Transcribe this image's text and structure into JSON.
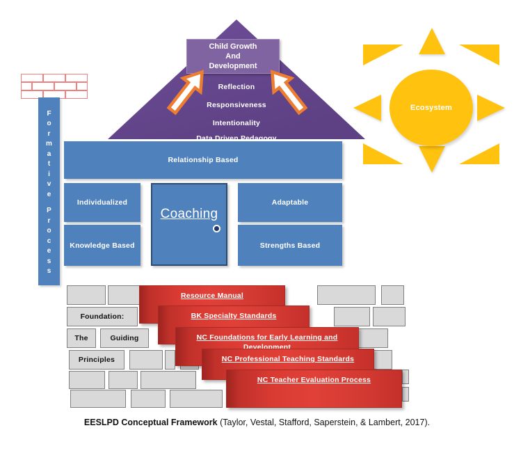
{
  "figure": {
    "caption_bold": "EESLPD Conceptual Framework",
    "caption_rest": " (Taylor, Vestal, Stafford, Saperstein, & Lambert, 2017)."
  },
  "colors": {
    "roof_purple": "#6E4F99",
    "header_purple": "#8064A2",
    "house_blue": "#4F81BD",
    "door_border": "#2B4B73",
    "sun_yellow": "#FFC20E",
    "banner_red": "#D93B33",
    "brick_gray": "#D9D9D9",
    "brick_gray_border": "#808080",
    "chimney_red": "#F08080",
    "arrow_orange": "#ED7D31"
  },
  "sun": {
    "label": "Ecosystem",
    "ray_count": 8
  },
  "chimney": {
    "rows": 3,
    "bricks_per_row": [
      3,
      4,
      3
    ]
  },
  "formative": {
    "label": "Formative Process",
    "letters_line1": [
      "F",
      "o",
      "r",
      "m",
      "a",
      "t",
      "i",
      "v",
      "e"
    ],
    "letters_line2": [
      "P",
      "r",
      "o",
      "c",
      "e",
      "s",
      "s"
    ]
  },
  "roof": {
    "header_box_lines": [
      "Child Growth",
      "And",
      "Development"
    ],
    "principles": [
      "Reflection",
      "Responsiveness",
      "Intentionality",
      "Data Driven Pedagogy"
    ]
  },
  "house": {
    "boxes": [
      {
        "id": "relationship",
        "label": "Relationship Based"
      },
      {
        "id": "individualized",
        "label": "Individualized"
      },
      {
        "id": "knowledge",
        "label": "Knowledge Based"
      },
      {
        "id": "adaptable",
        "label": "Adaptable"
      },
      {
        "id": "strengths",
        "label": "Strengths Based"
      },
      {
        "id": "coaching",
        "label": "Coaching"
      }
    ]
  },
  "foundation": {
    "labeled_bricks": [
      {
        "label": "Foundation:"
      },
      {
        "label": "The"
      },
      {
        "label": "Guiding"
      },
      {
        "label": "Principles"
      }
    ],
    "banners": [
      {
        "label": "Resource Manual"
      },
      {
        "label": "BK Specialty Standards"
      },
      {
        "label": "NC Foundations for Early Learning and Development"
      },
      {
        "label": "NC Professional Teaching Standards"
      },
      {
        "label": "NC Teacher Evaluation Process"
      }
    ]
  }
}
